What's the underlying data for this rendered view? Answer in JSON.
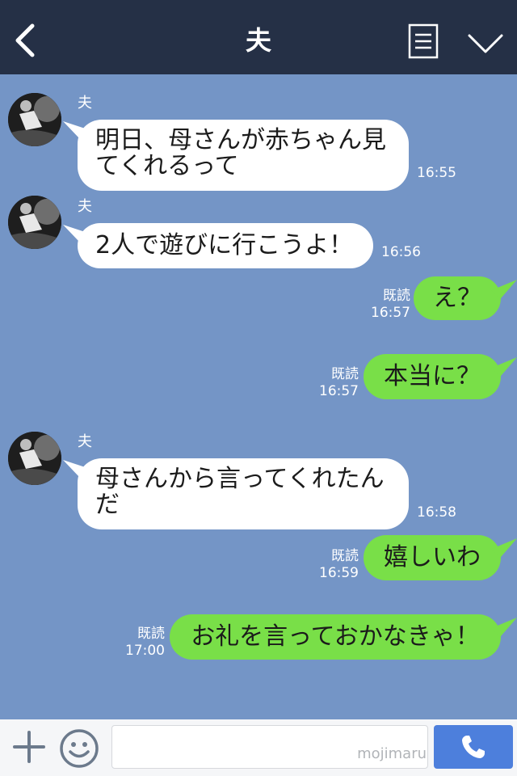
{
  "header": {
    "title": "夫",
    "back_icon": "chevron-left-icon",
    "notes_icon": "notes-icon",
    "menu_icon": "chevron-down-icon"
  },
  "messages": [
    {
      "from": "partner",
      "sender": "夫",
      "lines": [
        "明日、母さんが赤ちゃん見",
        "てくれるって"
      ],
      "time": "16:55"
    },
    {
      "from": "partner",
      "sender": "夫",
      "lines": [
        "2人で遊びに行こうよ！"
      ],
      "time": "16:56"
    },
    {
      "from": "me",
      "read": "既読",
      "time": "16:57",
      "text": "え？"
    },
    {
      "from": "me",
      "read": "既読",
      "time": "16:57",
      "text": "本当に？"
    },
    {
      "from": "partner",
      "sender": "夫",
      "lines": [
        "母さんから言ってくれたん",
        "だ"
      ],
      "time": "16:58"
    },
    {
      "from": "me",
      "read": "既読",
      "time": "16:59",
      "text": "嬉しいわ"
    },
    {
      "from": "me",
      "read": "既読",
      "time": "17:00",
      "text": "お礼を言っておかなきゃ！"
    }
  ],
  "input_bar": {
    "plus_icon": "plus-icon",
    "emoji_icon": "smiley-icon",
    "input_value": "",
    "watermark": "mojimaru",
    "call_icon": "phone-icon"
  },
  "colors": {
    "header_bg": "#253046",
    "chat_bg": "#7495c6",
    "sent_bubble": "#79df48",
    "received_bubble": "#ffffff",
    "call_button": "#4d7fdc"
  }
}
